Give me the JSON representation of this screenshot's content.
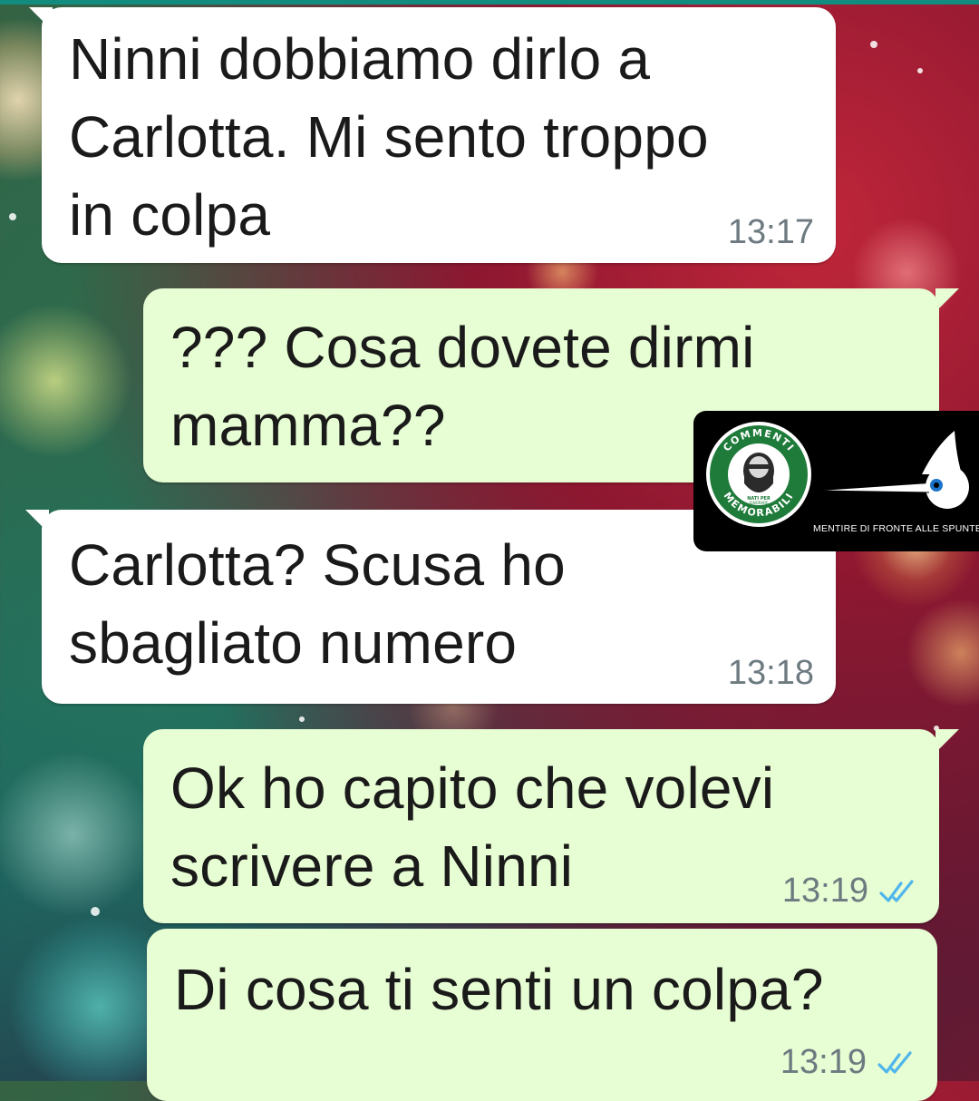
{
  "messages": [
    {
      "direction": "incoming",
      "text": "Ninni dobbiamo dirlo a\nCarlotta. Mi sento troppo\nin colpa",
      "time": "13:17"
    },
    {
      "direction": "outgoing",
      "text": "??? Cosa dovete dirmi\nmamma??",
      "time": ""
    },
    {
      "direction": "incoming",
      "text": "Carlotta? Scusa ho\nsbagliato numero",
      "time": "13:18"
    },
    {
      "direction": "outgoing",
      "text": "Ok ho capito che volevi\nscrivere a Ninni",
      "time": "13:19",
      "status_icon": "double-check-icon"
    },
    {
      "direction": "outgoing",
      "text": "Di cosa ti senti un colpa?",
      "time": "13:19",
      "status_icon": "double-check-icon"
    }
  ],
  "watermark": {
    "logo_text_top": "COMMENTI",
    "logo_text_bottom": "MEMORABILI",
    "logo_text_small": "NATI PER IGNORARE",
    "caption": "MENTIRE DI FRONTE ALLE SPUNTE BLU"
  },
  "colors": {
    "incoming_bubble": "#ffffff",
    "outgoing_bubble": "#e7fdd3",
    "read_tick": "#4fb6ec",
    "top_bar": "#128c7e",
    "logo_green": "#1e7b3a"
  }
}
